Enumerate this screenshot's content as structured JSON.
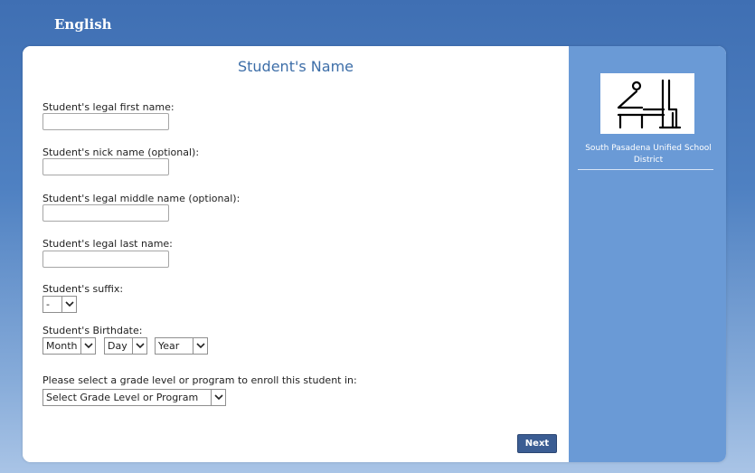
{
  "header": {
    "language": "English"
  },
  "form": {
    "title": "Student's Name",
    "first_name_label": "Student's legal first name:",
    "nick_name_label": "Student's nick name (optional):",
    "middle_name_label": "Student's legal middle name (optional):",
    "last_name_label": "Student's legal last name:",
    "suffix_label": "Student's suffix:",
    "suffix_value": "-",
    "birthdate_label": "Student's Birthdate:",
    "month_value": "Month",
    "day_value": "Day",
    "year_value": "Year",
    "grade_label": "Please select a grade level or program to enroll this student in:",
    "grade_value": "Select Grade Level or Program",
    "next_label": "Next"
  },
  "sidebar": {
    "district_name": "South Pasadena Unified School District"
  },
  "colors": {
    "accent": "#3d6ea8",
    "sidebar": "#6a9ad6",
    "button": "#3b5d93"
  }
}
